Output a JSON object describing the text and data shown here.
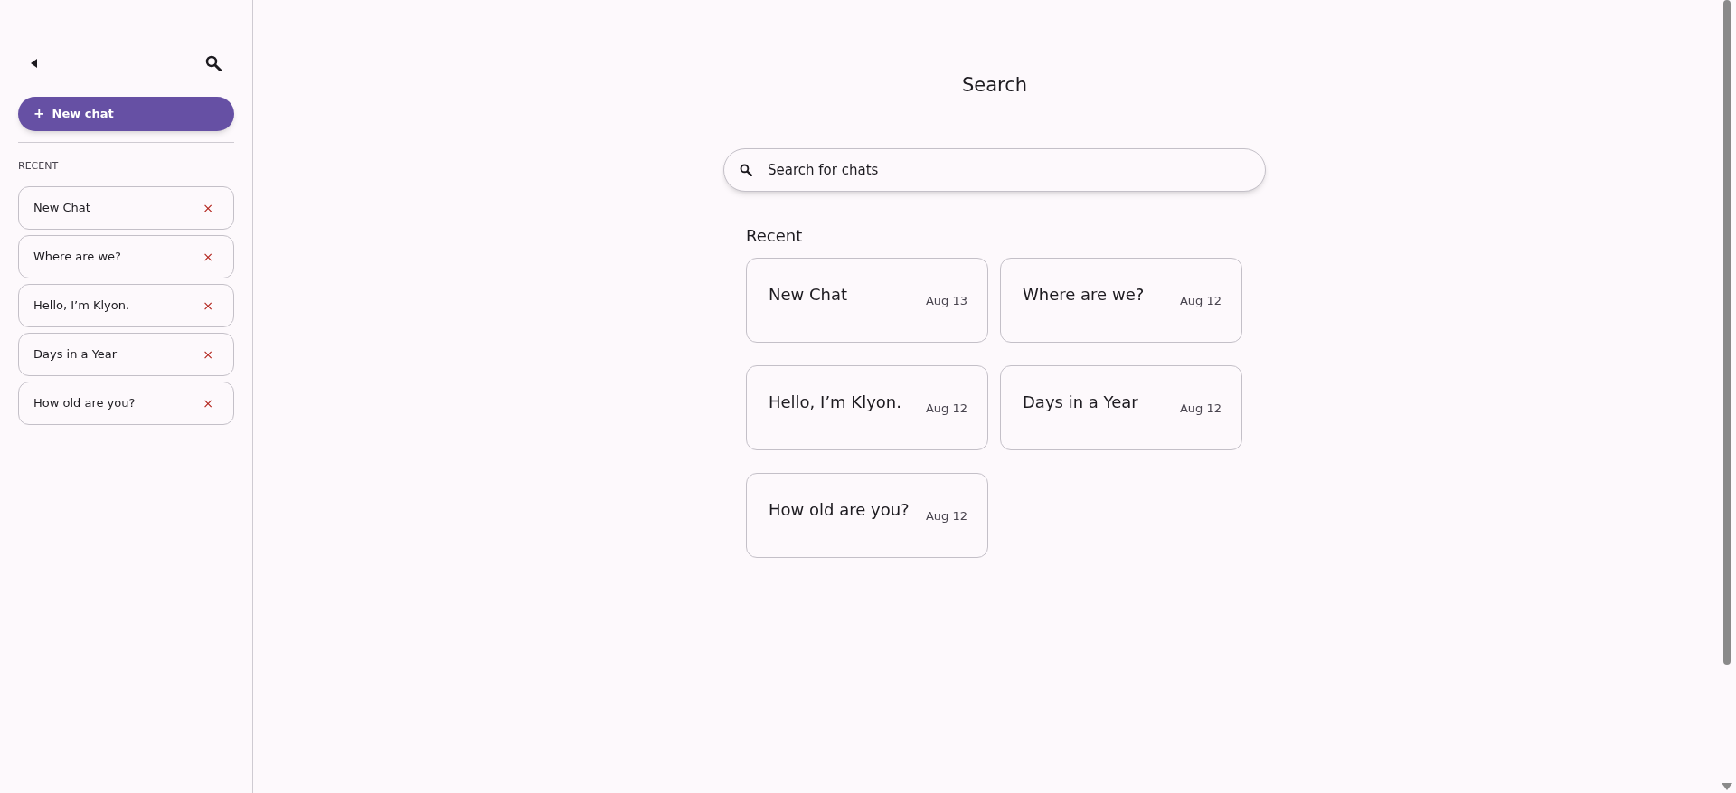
{
  "sidebar": {
    "new_chat_button": {
      "label": "New chat",
      "icon": "+"
    },
    "section_label": "RECENT",
    "items": [
      {
        "title": "New Chat",
        "remove": "×"
      },
      {
        "title": "Where are we?",
        "remove": "×"
      },
      {
        "title": "Hello, I’m Klyon.",
        "remove": "×"
      },
      {
        "title": "Days in a Year",
        "remove": "×"
      },
      {
        "title": "How old are you?",
        "remove": "×"
      }
    ]
  },
  "main": {
    "title": "Search",
    "search": {
      "placeholder": "Search for chats"
    },
    "section_label": "Recent",
    "cards": [
      {
        "title": "New Chat",
        "date": "Aug 13"
      },
      {
        "title": "Where are we?",
        "date": "Aug 12"
      },
      {
        "title": "Hello, I’m Klyon.",
        "date": "Aug 12"
      },
      {
        "title": "Days in a Year",
        "date": "Aug 12"
      },
      {
        "title": "How old are you?",
        "date": "Aug 12"
      }
    ]
  }
}
